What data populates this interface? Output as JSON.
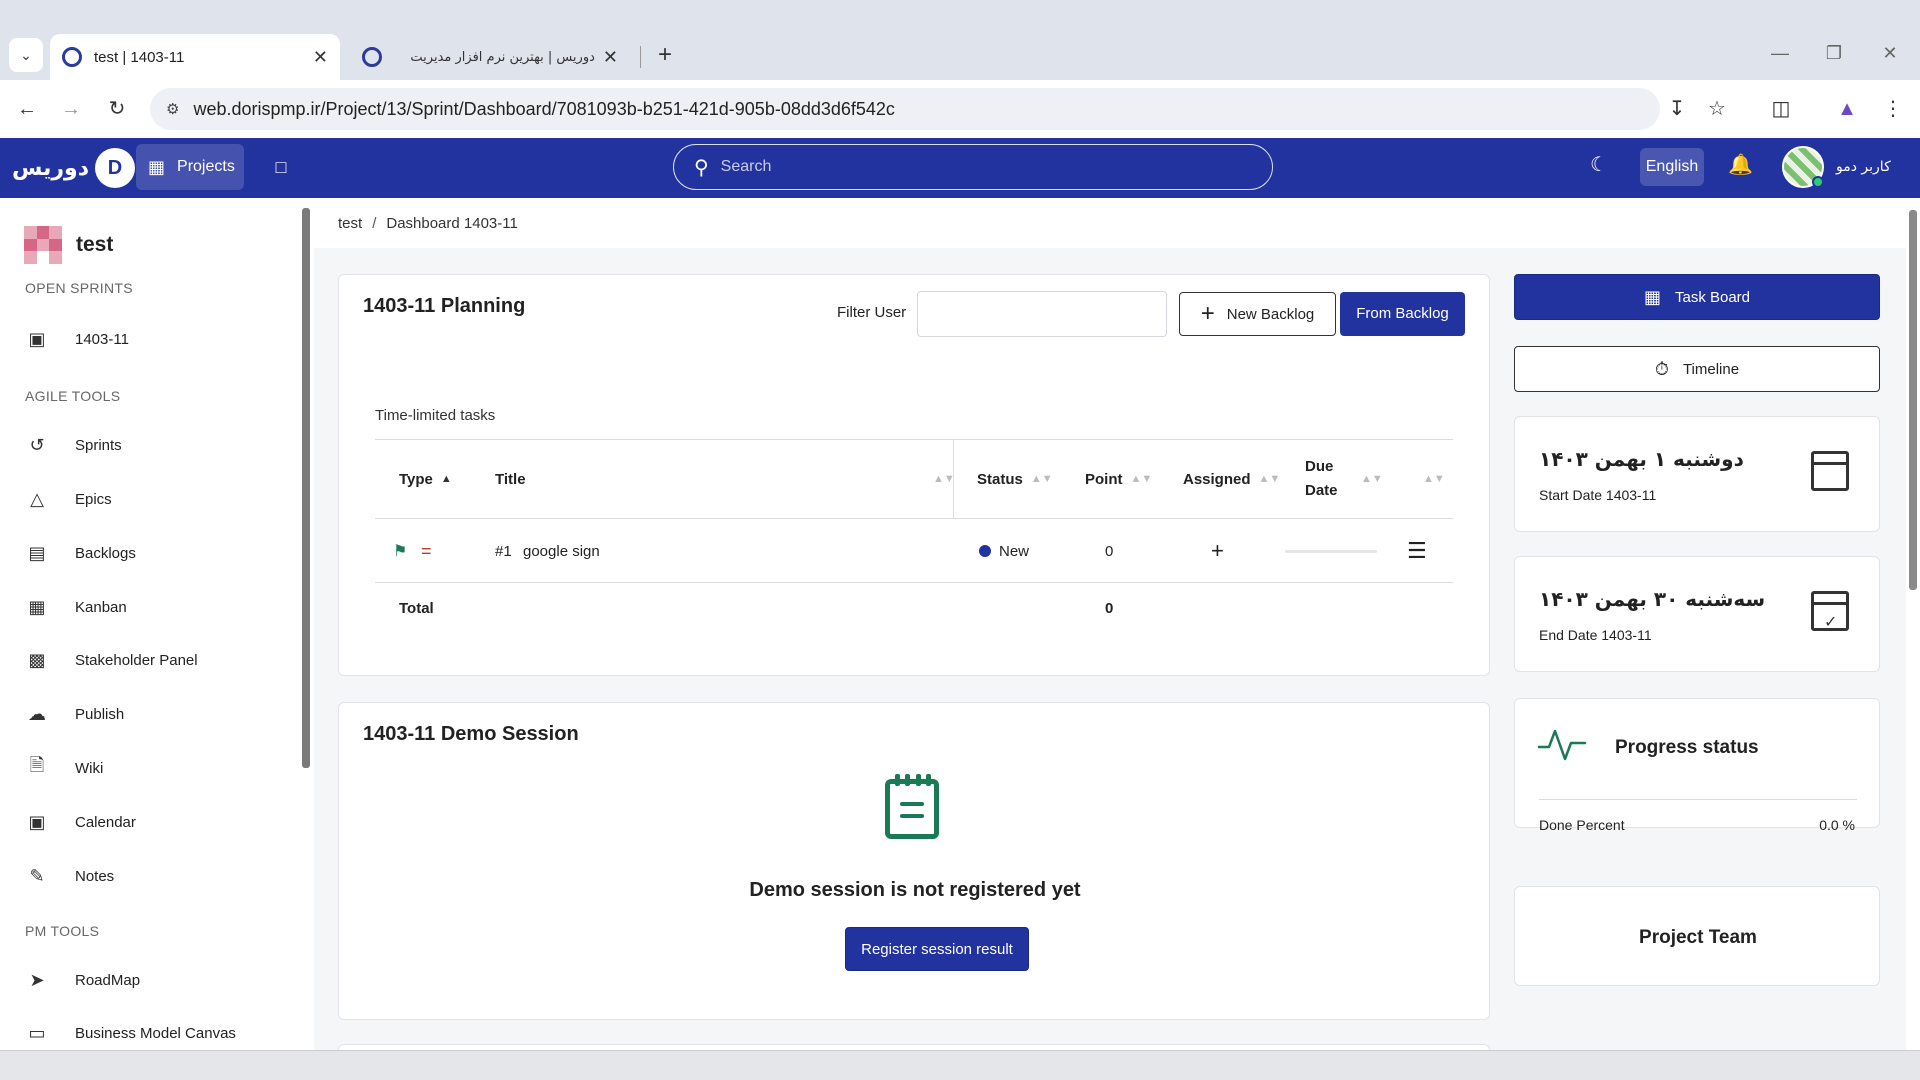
{
  "browser": {
    "tabs": [
      {
        "title": "test | 1403-11",
        "active": true
      },
      {
        "title": "دوریس | بهترین نرم افزار مدیریت",
        "active": false
      }
    ],
    "url": "web.dorispmp.ir/Project/13/Sprint/Dashboard/7081093b-b251-421d-905b-08dd3d6f542c"
  },
  "header": {
    "brand": "دوریس",
    "projects_label": "Projects",
    "search_placeholder": "Search",
    "language_label": "English",
    "user_name": "کاربر دمو"
  },
  "sidebar": {
    "project_name": "test",
    "sections": {
      "open_sprints": "OPEN SPRINTS",
      "agile_tools": "AGILE TOOLS",
      "pm_tools": "PM TOOLS"
    },
    "sprint_item": "1403-11",
    "agile_items": [
      "Sprints",
      "Epics",
      "Backlogs",
      "Kanban",
      "Stakeholder Panel",
      "Publish",
      "Wiki",
      "Calendar",
      "Notes"
    ],
    "pm_items": [
      "RoadMap",
      "Business Model Canvas"
    ]
  },
  "breadcrumb": {
    "project": "test",
    "separator": "/",
    "current": "Dashboard 1403-11"
  },
  "planning": {
    "title": "1403-11 Planning",
    "filter_label": "Filter User",
    "new_backlog_label": "New Backlog",
    "from_backlog_label": "From Backlog",
    "section_label": "Time-limited tasks",
    "columns": {
      "type": "Type",
      "title": "Title",
      "status": "Status",
      "point": "Point",
      "assigned": "Assigned",
      "due_date_1": "Due",
      "due_date_2": "Date"
    },
    "rows": [
      {
        "number": "#1",
        "title": "google sign",
        "status": "New",
        "point": "0"
      }
    ],
    "total_label": "Total",
    "total_value": "0"
  },
  "demo": {
    "title": "1403-11 Demo Session",
    "message": "Demo session is not registered yet",
    "register_label": "Register session result"
  },
  "right_panel": {
    "task_board_label": "Task Board",
    "timeline_label": "Timeline",
    "start_date_fa": "دوشنبه ۱ بهمن ۱۴۰۳",
    "start_date_label": "Start Date 1403-11",
    "end_date_fa": "سه‌شنبه ۳۰ بهمن ۱۴۰۳",
    "end_date_label": "End Date 1403-11",
    "progress_title": "Progress status",
    "done_percent_label": "Done Percent",
    "done_percent_value": "0.0 %",
    "team_title": "Project Team"
  },
  "colors": {
    "primary": "#2233a0",
    "accent_green": "#1a7a55",
    "status_new": "#2233a0"
  }
}
